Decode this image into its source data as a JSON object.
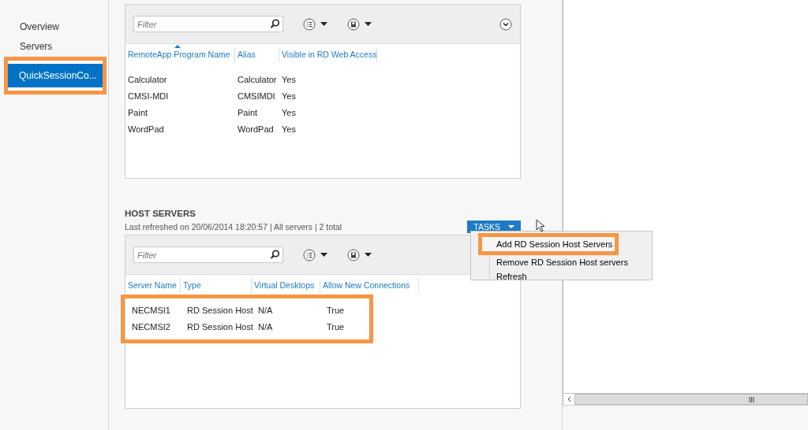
{
  "sidebar": {
    "items": [
      {
        "label": "Overview",
        "selected": false,
        "highlighted": false
      },
      {
        "label": "Servers",
        "selected": false,
        "highlighted": false
      },
      {
        "label": "QuickSessionCo...",
        "selected": true,
        "highlighted": true
      }
    ]
  },
  "remoteapp_programs": {
    "filter": {
      "placeholder": "Filter"
    },
    "columns": [
      {
        "label": "RemoteApp Program Name",
        "sorted": true
      },
      {
        "label": "Alias",
        "sorted": false
      },
      {
        "label": "Visible in RD Web Access",
        "sorted": false
      }
    ],
    "rows": [
      [
        "Calculator",
        "Calculator",
        "Yes"
      ],
      [
        "CMSI-MDI",
        "CMSIMDI",
        "Yes"
      ],
      [
        "Paint",
        "Paint",
        "Yes"
      ],
      [
        "WordPad",
        "WordPad",
        "Yes"
      ]
    ]
  },
  "host_servers": {
    "title": "HOST SERVERS",
    "subtitle": "Last refreshed on 20/06/2014 18:20:57 | All servers  | 2 total",
    "tasks_button": "TASKS",
    "tasks_menu": [
      {
        "label": "Add RD Session Host Servers",
        "highlighted": true
      },
      {
        "label": "Remove RD Session Host servers",
        "highlighted": false
      },
      {
        "label": "Refresh",
        "highlighted": false
      }
    ],
    "filter": {
      "placeholder": "Filter"
    },
    "columns": [
      {
        "label": "Server Name",
        "sorted": false
      },
      {
        "label": "Type",
        "sorted": false
      },
      {
        "label": "Virtual Desktops",
        "sorted": false
      },
      {
        "label": "Allow New Connections",
        "sorted": false
      }
    ],
    "rows_highlighted": true,
    "rows": [
      [
        "NECMSI1",
        "RD Session Host",
        "N/A",
        "True"
      ],
      [
        "NECMSI2",
        "RD Session Host",
        "N/A",
        "True"
      ]
    ]
  }
}
